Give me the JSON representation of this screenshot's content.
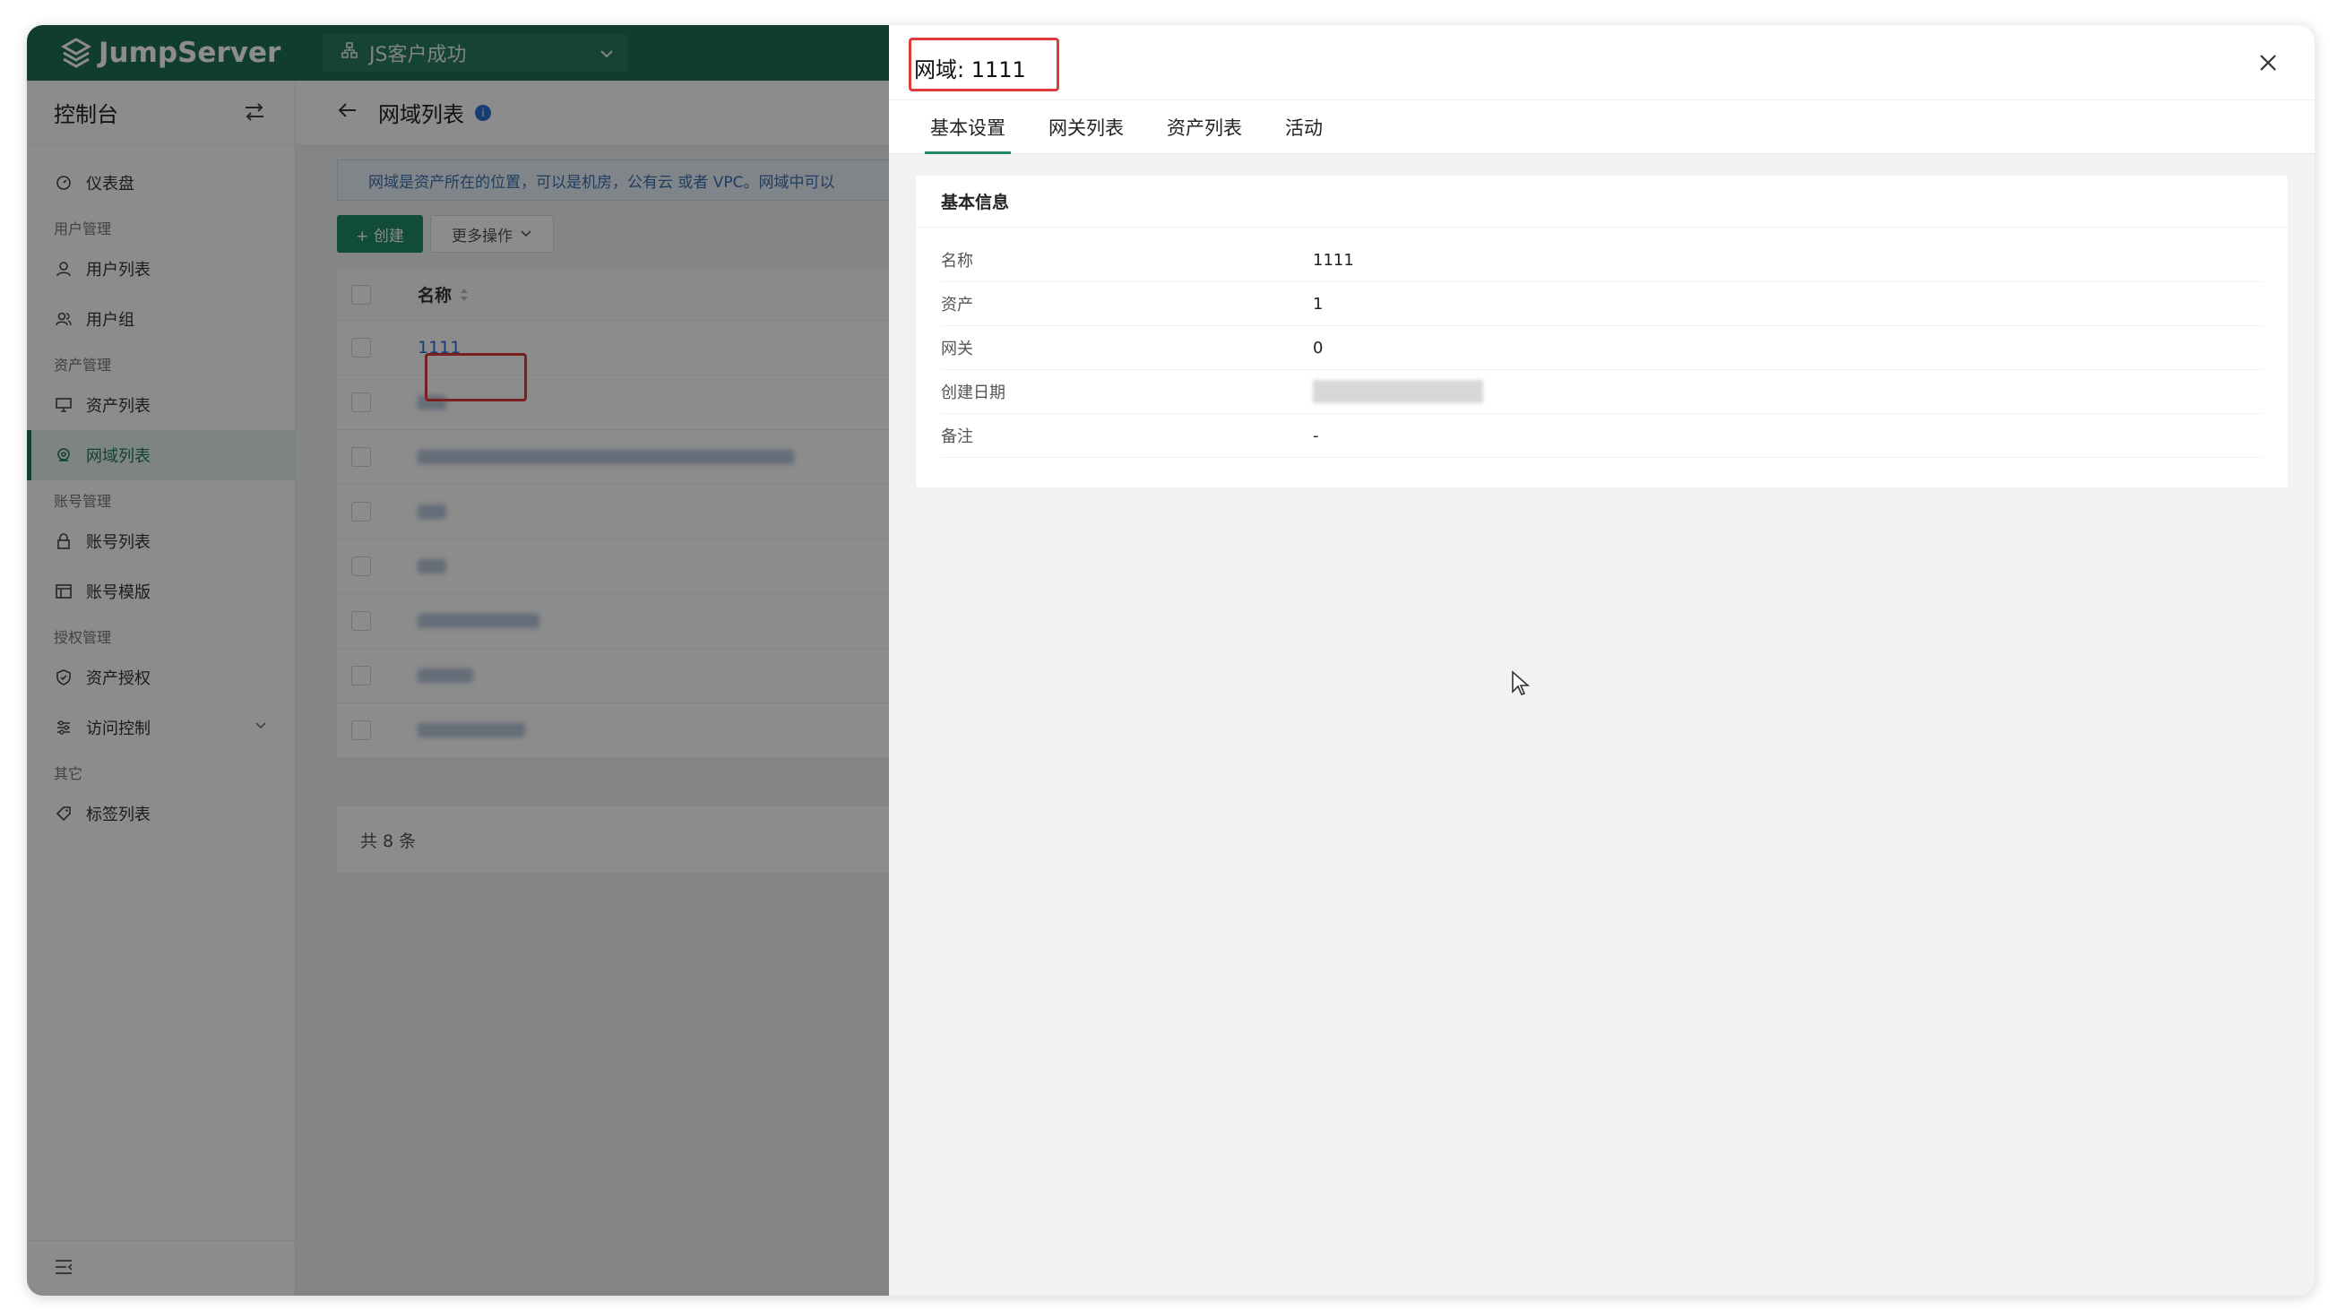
{
  "app": {
    "brand": "JumpServer",
    "org_selector": "JS客户成功"
  },
  "sidebar": {
    "title": "控制台",
    "items": [
      {
        "type": "item",
        "label": "仪表盘",
        "icon": "dashboard-icon"
      },
      {
        "type": "group",
        "label": "用户管理"
      },
      {
        "type": "item",
        "label": "用户列表",
        "icon": "user-icon"
      },
      {
        "type": "item",
        "label": "用户组",
        "icon": "users-icon"
      },
      {
        "type": "group",
        "label": "资产管理"
      },
      {
        "type": "item",
        "label": "资产列表",
        "icon": "monitor-icon"
      },
      {
        "type": "item",
        "label": "网域列表",
        "icon": "location-icon",
        "active": true
      },
      {
        "type": "group",
        "label": "账号管理"
      },
      {
        "type": "item",
        "label": "账号列表",
        "icon": "lock-icon"
      },
      {
        "type": "item",
        "label": "账号模版",
        "icon": "template-icon"
      },
      {
        "type": "group",
        "label": "授权管理"
      },
      {
        "type": "item",
        "label": "资产授权",
        "icon": "shield-icon"
      },
      {
        "type": "item",
        "label": "访问控制",
        "icon": "control-icon",
        "expandable": true
      },
      {
        "type": "group",
        "label": "其它"
      },
      {
        "type": "item",
        "label": "标签列表",
        "icon": "tag-icon"
      }
    ]
  },
  "page": {
    "title": "网域列表",
    "notice": "网域是资产所在的位置，可以是机房，公有云 或者 VPC。网域中可以",
    "create_label": "+ 创建",
    "more_label": "更多操作",
    "table": {
      "name_header": "名称",
      "first_row_name": "1111"
    },
    "total": "共 8 条"
  },
  "drawer": {
    "title": "网域: 1111",
    "tabs": [
      "基本设置",
      "网关列表",
      "资产列表",
      "活动"
    ],
    "active_tab": 0,
    "card_title": "基本信息",
    "rows": [
      {
        "label": "名称",
        "value": "1111"
      },
      {
        "label": "资产",
        "value": "1"
      },
      {
        "label": "网关",
        "value": "0"
      },
      {
        "label": "创建日期",
        "value": ""
      },
      {
        "label": "备注",
        "value": "-"
      }
    ]
  },
  "colors": {
    "brand": "#1f6f56",
    "accent": "#1f8a64",
    "link": "#2b6fd1",
    "highlight": "#e03b3b"
  }
}
